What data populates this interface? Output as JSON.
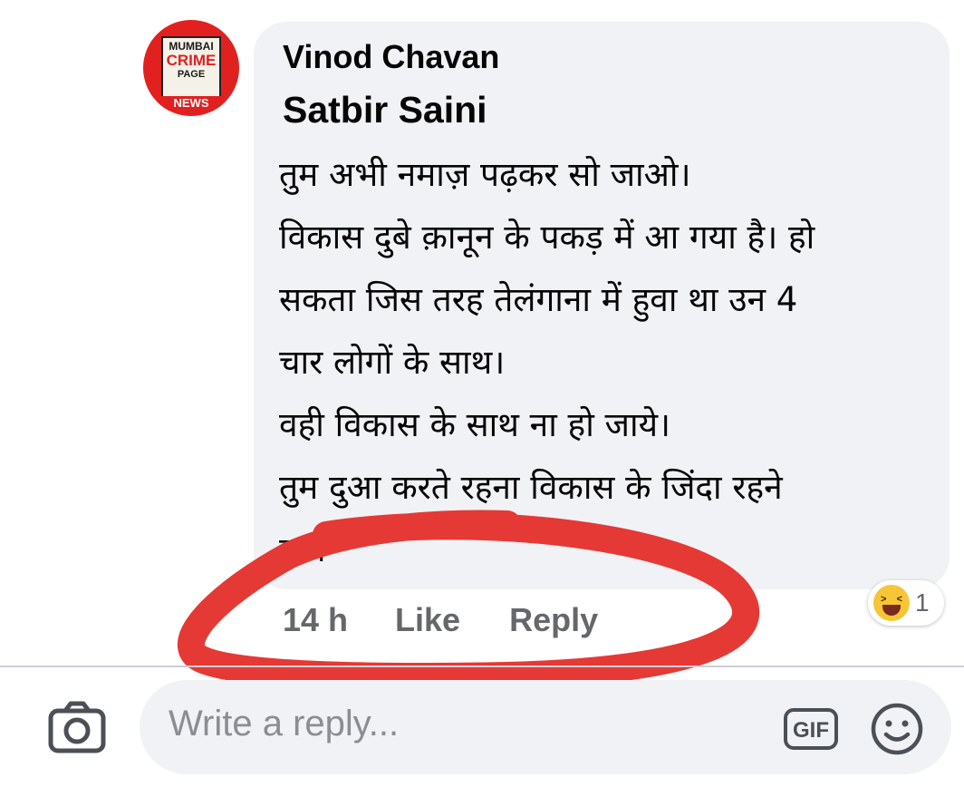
{
  "avatar": {
    "logo_line1": "MUMBAI",
    "logo_line2": "CRIME",
    "logo_line3": "PAGE",
    "logo_line4": "NEWS"
  },
  "comment": {
    "author": "Vinod Chavan",
    "mention": "Satbir Saini",
    "lines": [
      "तुम अभी नमाज़ पढ़कर सो जाओ।",
      "विकास दुबे क़ानून के पकड़ में आ गया है। हो",
      "सकता जिस तरह तेलंगाना में हुवा था उन 4",
      "चार लोगों के साथ।",
      "वही विकास के साथ ना हो जाये।",
      "तुम दुआ करते रहना विकास के जिंदा रहने",
      "का।"
    ],
    "timestamp": "14 h",
    "like_label": "Like",
    "reply_label": "Reply",
    "reaction": {
      "icon": "laughing-emoji-icon",
      "count": "1"
    }
  },
  "composer": {
    "placeholder": "Write a reply...",
    "gif_label": "GIF",
    "camera_icon": "camera-icon",
    "emoji_icon": "smiley-icon"
  },
  "colors": {
    "bubble": "#f0f2f5",
    "meta_text": "#65676b",
    "annotation_red": "#e53935"
  }
}
